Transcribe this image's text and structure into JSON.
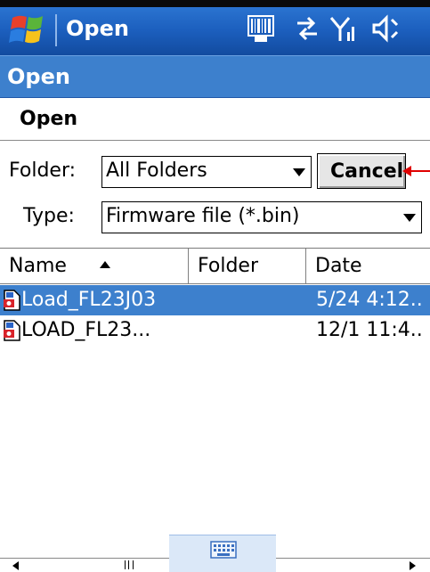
{
  "titlebar": {
    "title": "Open",
    "icons": [
      "windows-start-icon",
      "barcode-icon",
      "connectivity-icon",
      "signal-icon",
      "volume-icon"
    ]
  },
  "dialog": {
    "caption": "Open",
    "subheader": "Open",
    "folder_label": "Folder:",
    "folder_value": "All Folders",
    "type_label": "Type:",
    "type_value": "Firmware file (*.bin)",
    "cancel_label": "Cancel"
  },
  "list": {
    "columns": [
      "Name",
      "Folder",
      "Date"
    ],
    "rows": [
      {
        "name": "Load_FL23J03",
        "folder": "",
        "date": "5/24 4:12..",
        "selected": true
      },
      {
        "name": "LOAD_FL23...",
        "folder": "",
        "date": "12/1 11:4..",
        "selected": false
      }
    ]
  },
  "colors": {
    "titlebar": "#1c5fbe",
    "caption": "#3d80cd",
    "selection": "#3d80cd",
    "callout_arrow": "#e00000"
  }
}
